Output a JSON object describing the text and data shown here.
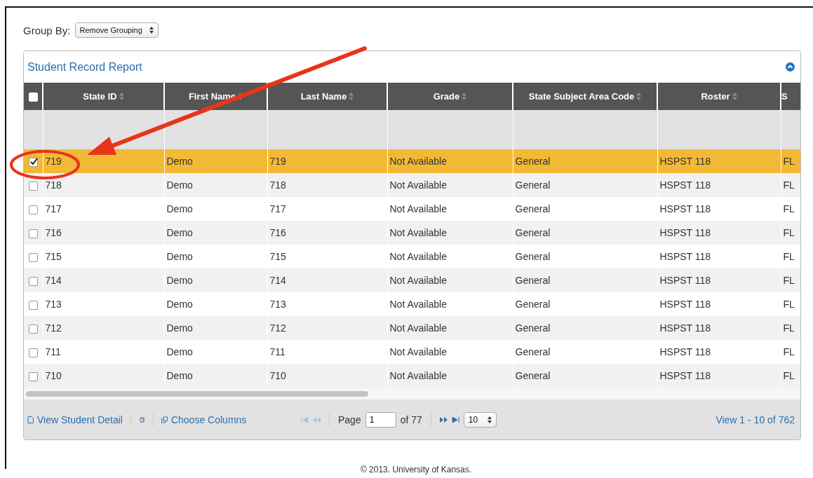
{
  "group_by": {
    "label": "Group By:",
    "value": "Remove Grouping"
  },
  "report": {
    "title": "Student Record Report",
    "table": {
      "select_all_checked": false,
      "columns": [
        {
          "label": "State ID",
          "sortable": true
        },
        {
          "label": "First Name",
          "sortable": true
        },
        {
          "label": "Last Name",
          "sortable": true
        },
        {
          "label": "Grade",
          "sortable": true
        },
        {
          "label": "State Subject Area Code",
          "sortable": true
        },
        {
          "label": "Roster",
          "sortable": true
        },
        {
          "label": "S",
          "sortable": false
        }
      ],
      "rows": [
        {
          "checked": true,
          "selected": true,
          "cells": [
            "719",
            "Demo",
            "719",
            "Not Available",
            "General",
            "HSPST 118",
            "FL"
          ]
        },
        {
          "checked": false,
          "selected": false,
          "cells": [
            "718",
            "Demo",
            "718",
            "Not Available",
            "General",
            "HSPST 118",
            "FL"
          ]
        },
        {
          "checked": false,
          "selected": false,
          "cells": [
            "717",
            "Demo",
            "717",
            "Not Available",
            "General",
            "HSPST 118",
            "FL"
          ]
        },
        {
          "checked": false,
          "selected": false,
          "cells": [
            "716",
            "Demo",
            "716",
            "Not Available",
            "General",
            "HSPST 118",
            "FL"
          ]
        },
        {
          "checked": false,
          "selected": false,
          "cells": [
            "715",
            "Demo",
            "715",
            "Not Available",
            "General",
            "HSPST 118",
            "FL"
          ]
        },
        {
          "checked": false,
          "selected": false,
          "cells": [
            "714",
            "Demo",
            "714",
            "Not Available",
            "General",
            "HSPST 118",
            "FL"
          ]
        },
        {
          "checked": false,
          "selected": false,
          "cells": [
            "713",
            "Demo",
            "713",
            "Not Available",
            "General",
            "HSPST 118",
            "FL"
          ]
        },
        {
          "checked": false,
          "selected": false,
          "cells": [
            "712",
            "Demo",
            "712",
            "Not Available",
            "General",
            "HSPST 118",
            "FL"
          ]
        },
        {
          "checked": false,
          "selected": false,
          "cells": [
            "711",
            "Demo",
            "711",
            "Not Available",
            "General",
            "HSPST 118",
            "FL"
          ]
        },
        {
          "checked": false,
          "selected": false,
          "cells": [
            "710",
            "Demo",
            "710",
            "Not Available",
            "General",
            "HSPST 118",
            "FL"
          ]
        }
      ]
    },
    "footer": {
      "view_detail": "View Student Detail",
      "choose_columns": "Choose Columns",
      "page_label": "Page",
      "page": "1",
      "page_count": "of 77",
      "page_size": "10",
      "record_info": "View 1 - 10 of 762"
    }
  },
  "copyright": "© 2013. University of Kansas."
}
